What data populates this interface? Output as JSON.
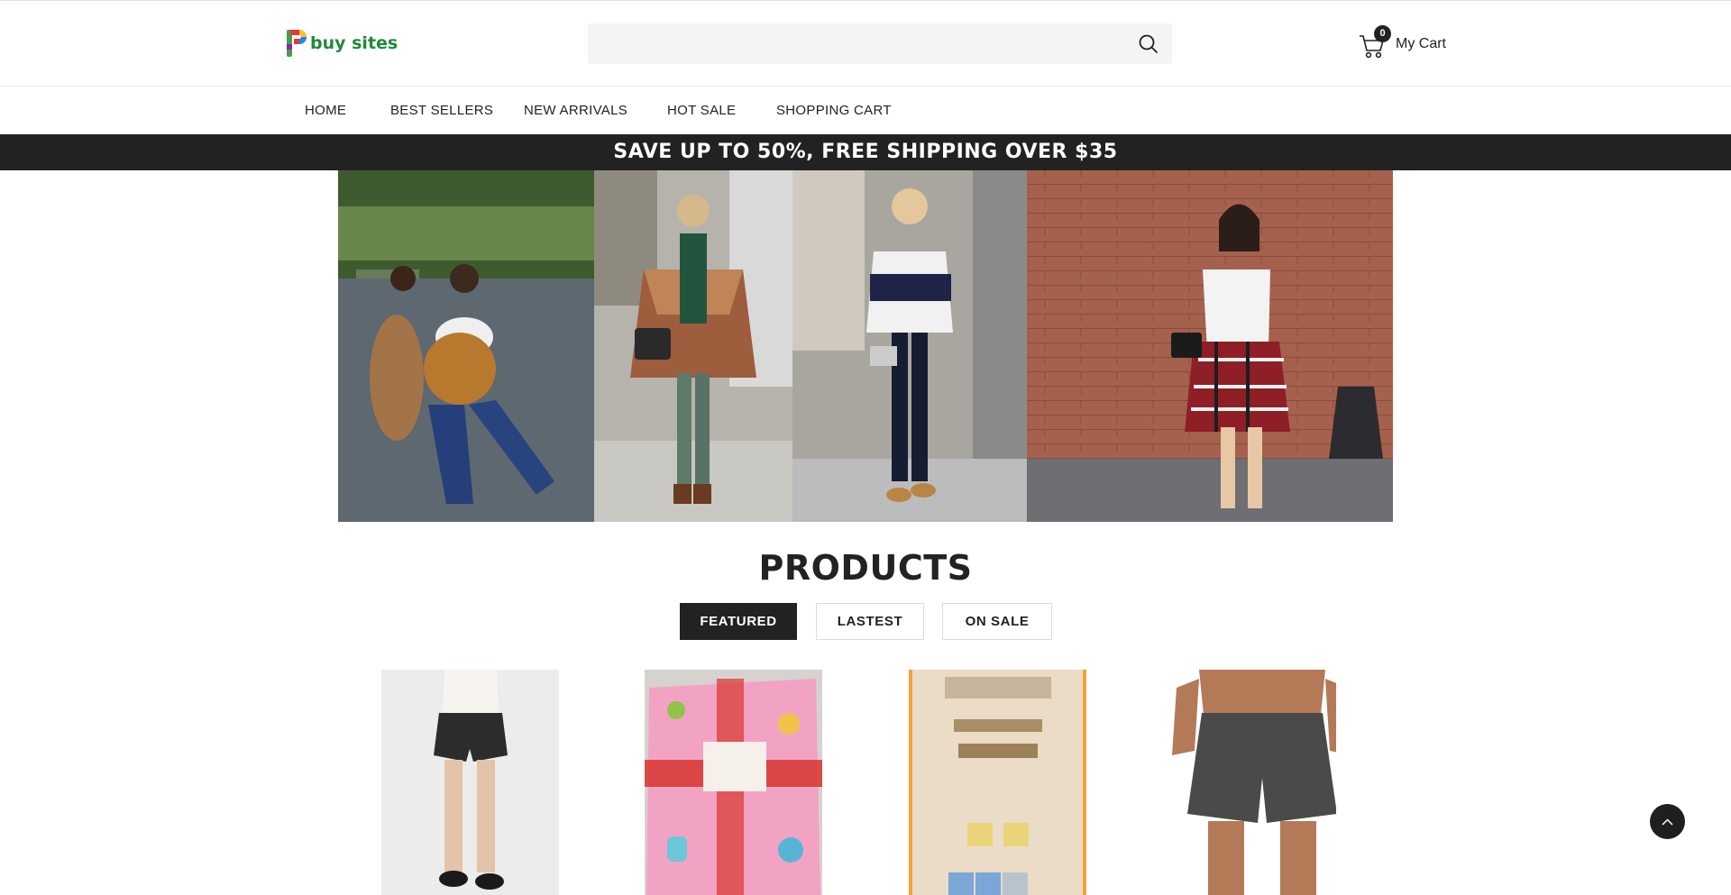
{
  "brand": {
    "logo_text": "buy sites",
    "logo_colors": [
      "#e53935",
      "#fbc02d",
      "#1e88e5",
      "#43a047"
    ]
  },
  "search": {
    "placeholder": "",
    "value": "",
    "icon": "search-icon"
  },
  "cart": {
    "count": "0",
    "label": "My Cart",
    "icon": "cart-icon"
  },
  "nav": {
    "items": [
      {
        "label": "HOME"
      },
      {
        "label": "BEST SELLERS"
      },
      {
        "label": "NEW ARRIVALS"
      },
      {
        "label": "HOT SALE"
      },
      {
        "label": "SHOPPING CART"
      }
    ]
  },
  "promo": {
    "text": "SAVE UP TO 50%, FREE SHIPPING OVER $35",
    "background": "#222222"
  },
  "hero": {
    "panels": [
      {
        "name": "two-women-street-photo"
      },
      {
        "name": "woman-plaid-poncho-photo"
      },
      {
        "name": "woman-striped-tee-photo"
      },
      {
        "name": "woman-plaid-shirt-waist-photo"
      }
    ]
  },
  "products": {
    "title": "PRODUCTS",
    "tabs": [
      {
        "label": "FEATURED",
        "active": true
      },
      {
        "label": "LASTEST",
        "active": false
      },
      {
        "label": "ON SALE",
        "active": false
      }
    ],
    "items": [
      {
        "name": "black-denim-shorts-product"
      },
      {
        "name": "pink-hello-kitty-blanket-product"
      },
      {
        "name": "photocard-collection-product"
      },
      {
        "name": "grey-swim-shorts-product"
      }
    ]
  },
  "scroll_top": {
    "icon": "chevron-up-icon"
  },
  "colors": {
    "accent_dark": "#222222",
    "search_bg": "#f4f4f4",
    "border": "#dcdcdc"
  }
}
